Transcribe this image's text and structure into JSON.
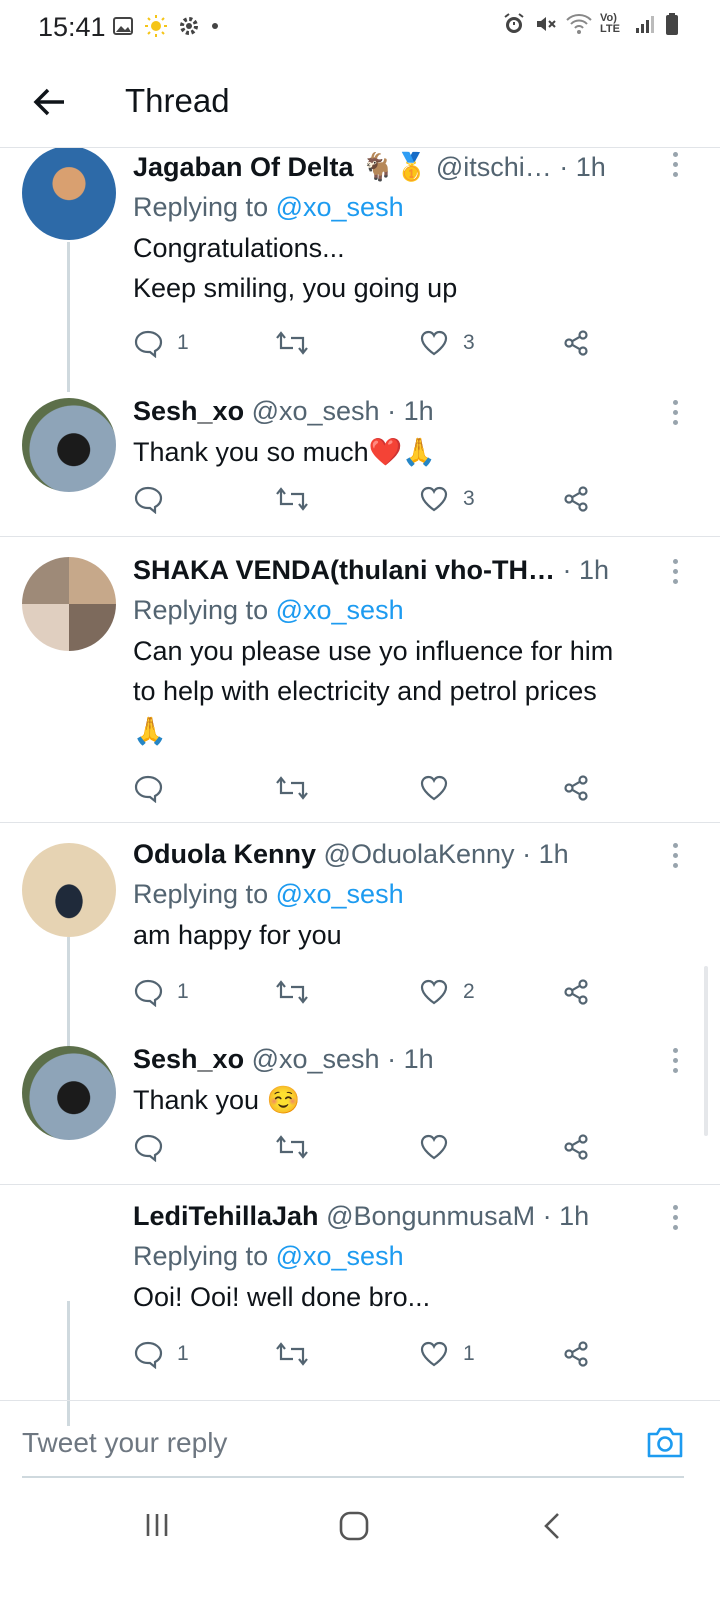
{
  "status_bar": {
    "time": "15:41",
    "network": "Vo) LTE"
  },
  "header": {
    "title": "Thread"
  },
  "tweets": [
    {
      "name": "Jagaban Of Delta",
      "name_emoji": "🐐🥇",
      "handle": "@itschi…",
      "time": "· 1h",
      "replying_prefix": "Replying to",
      "replying_handle": "@xo_sesh",
      "text_lines": [
        "Congratulations...",
        "Keep smiling, you going up"
      ],
      "reply_count": "1",
      "retweet_count": "",
      "like_count": "3",
      "avatar_color": "#b07a4f"
    },
    {
      "name": "Sesh_xo",
      "handle": "@xo_sesh",
      "time": "· 1h",
      "text_lines": [
        "Thank you so much❤️🙏"
      ],
      "reply_count": "",
      "retweet_count": "",
      "like_count": "3",
      "avatar_color": "#6b7f8c"
    },
    {
      "name": "SHAKA VENDA(thulani vho-TH…",
      "handle": "",
      "time": "· 1h",
      "replying_prefix": "Replying to",
      "replying_handle": "@xo_sesh",
      "text_lines": [
        "Can you please use yo influence for him",
        "to help with electricity and petrol prices",
        "🙏"
      ],
      "reply_count": "",
      "retweet_count": "",
      "like_count": "",
      "avatar_color": "#9a8c80"
    },
    {
      "name": "Oduola Kenny",
      "handle": "@OduolaKenny",
      "time": "· 1h",
      "replying_prefix": "Replying to",
      "replying_handle": "@xo_sesh",
      "text_lines": [
        "am happy for you"
      ],
      "reply_count": "1",
      "retweet_count": "",
      "like_count": "2",
      "avatar_color": "#c9b89a"
    },
    {
      "name": "Sesh_xo",
      "handle": "@xo_sesh",
      "time": "· 1h",
      "text_lines": [
        "Thank you ☺️"
      ],
      "reply_count": "",
      "retweet_count": "",
      "like_count": "",
      "avatar_color": "#6b7f8c"
    },
    {
      "name": "LediTehillaJah",
      "handle": "@BongunmusaM",
      "time": "· 1h",
      "replying_prefix": "Replying to",
      "replying_handle": "@xo_sesh",
      "text_lines": [
        "Ooi! Ooi! well done bro..."
      ],
      "reply_count": "1",
      "retweet_count": "",
      "like_count": "1"
    }
  ],
  "composer": {
    "placeholder": "Tweet your reply"
  },
  "colors": {
    "accent": "#1d9bf0",
    "secondary_text": "#536471",
    "divider": "#e1e4e8"
  }
}
